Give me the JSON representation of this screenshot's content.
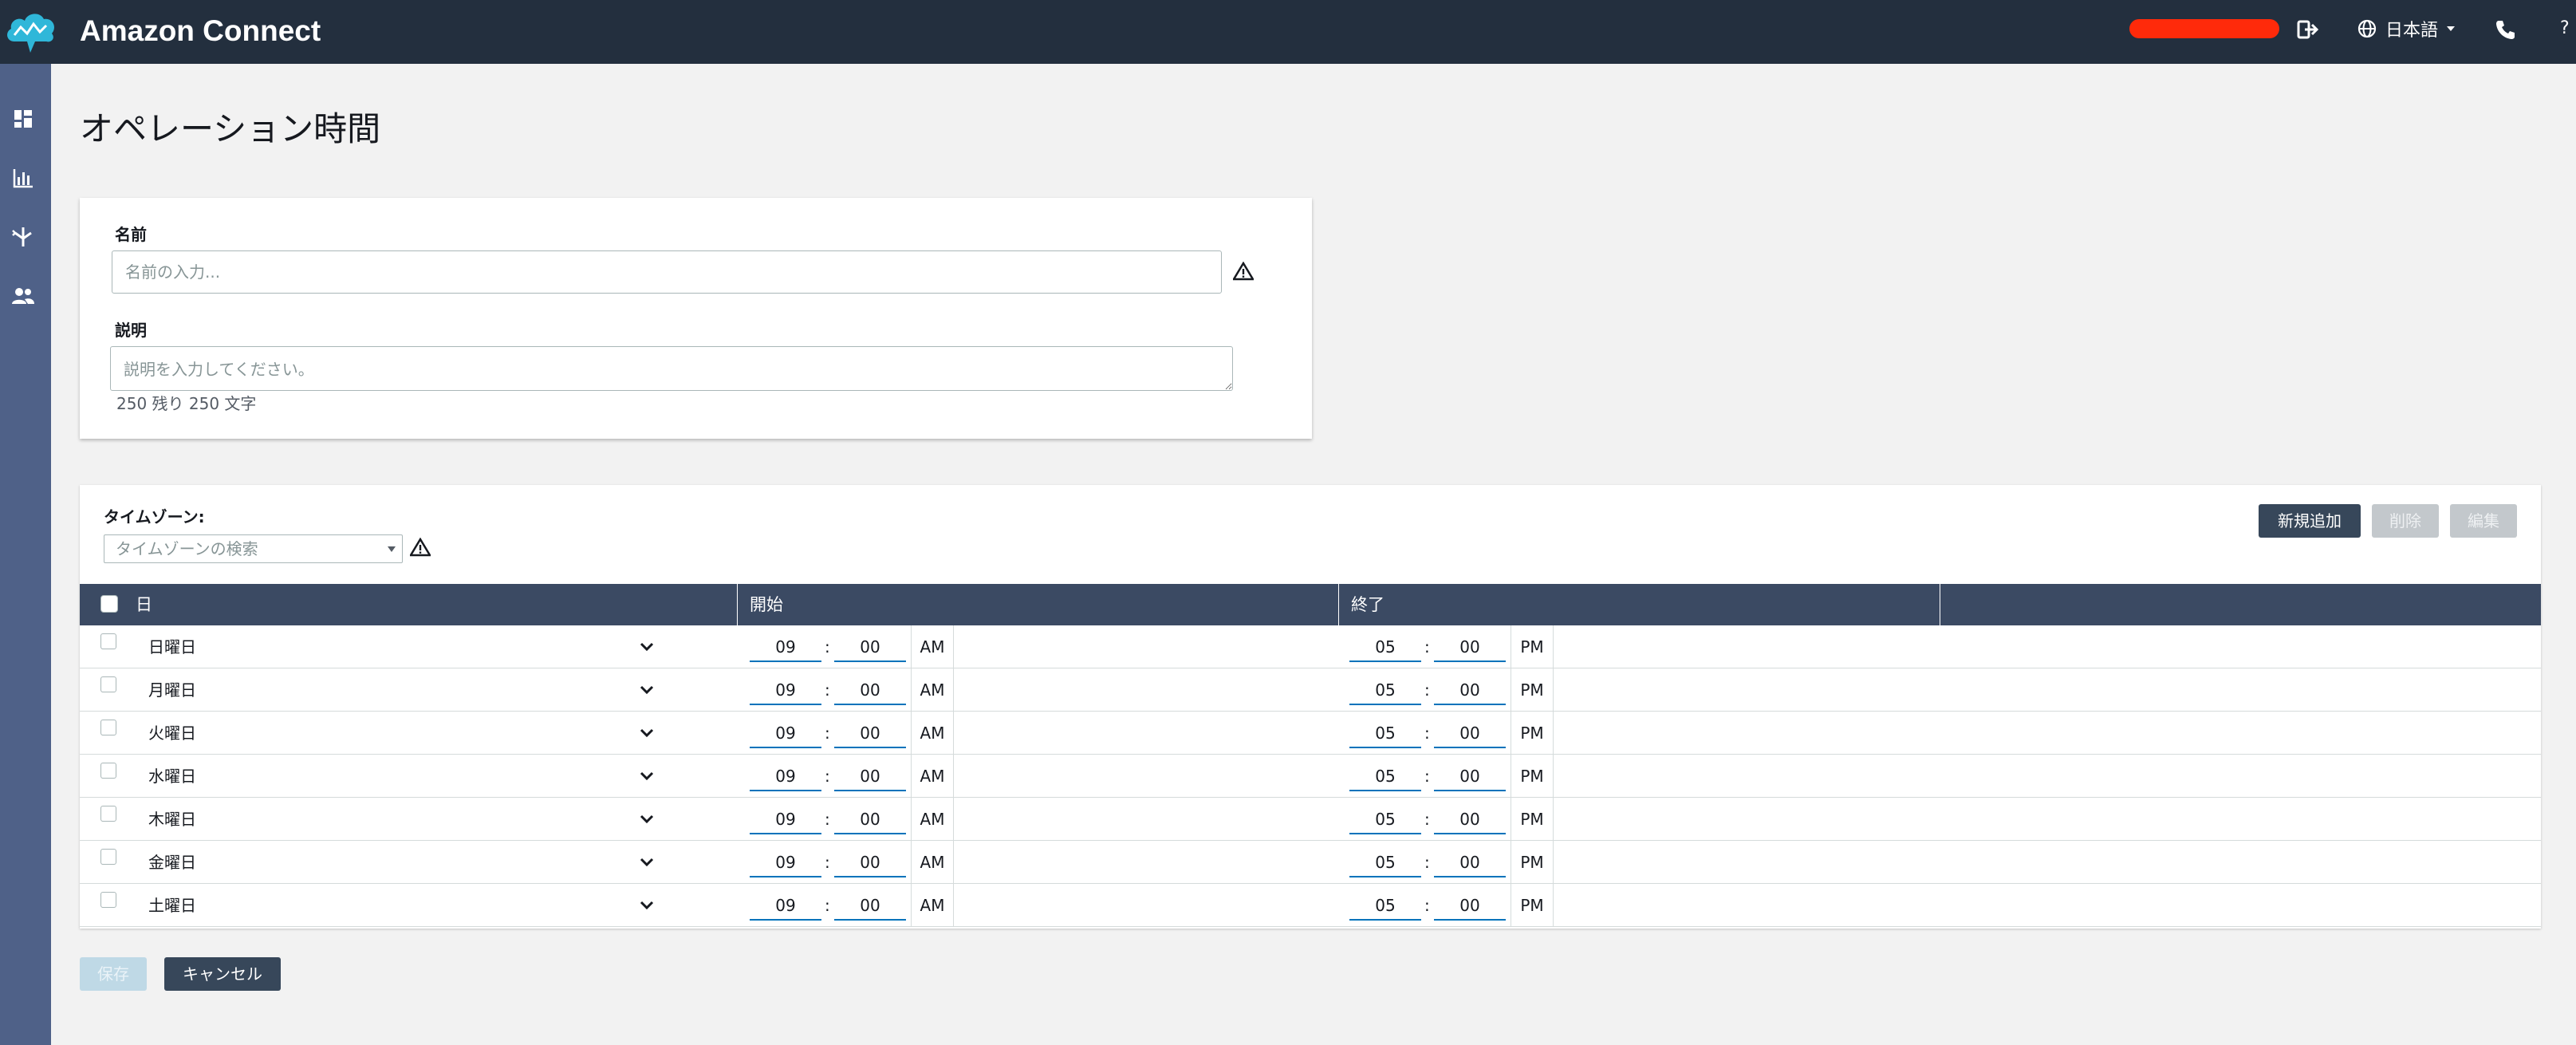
{
  "header": {
    "brand": "Amazon Connect",
    "language": "日本語",
    "help": "?"
  },
  "page": {
    "title": "オペレーション時間"
  },
  "form": {
    "name_label": "名前",
    "name_placeholder": "名前の入力...",
    "description_label": "説明",
    "description_placeholder": "説明を入力してください。",
    "counter": "250 残り 250 文字"
  },
  "timezone": {
    "label": "タイムゾーン:",
    "placeholder": "タイムゾーンの検索"
  },
  "actions": {
    "add": "新規追加",
    "delete": "削除",
    "edit": "編集"
  },
  "table": {
    "columns": {
      "day": "日",
      "start": "開始",
      "end": "終了"
    },
    "colon": ":",
    "rows": [
      {
        "day": "日曜日",
        "start_h": "09",
        "start_m": "00",
        "start_ampm": "AM",
        "end_h": "05",
        "end_m": "00",
        "end_ampm": "PM"
      },
      {
        "day": "月曜日",
        "start_h": "09",
        "start_m": "00",
        "start_ampm": "AM",
        "end_h": "05",
        "end_m": "00",
        "end_ampm": "PM"
      },
      {
        "day": "火曜日",
        "start_h": "09",
        "start_m": "00",
        "start_ampm": "AM",
        "end_h": "05",
        "end_m": "00",
        "end_ampm": "PM"
      },
      {
        "day": "水曜日",
        "start_h": "09",
        "start_m": "00",
        "start_ampm": "AM",
        "end_h": "05",
        "end_m": "00",
        "end_ampm": "PM"
      },
      {
        "day": "木曜日",
        "start_h": "09",
        "start_m": "00",
        "start_ampm": "AM",
        "end_h": "05",
        "end_m": "00",
        "end_ampm": "PM"
      },
      {
        "day": "金曜日",
        "start_h": "09",
        "start_m": "00",
        "start_ampm": "AM",
        "end_h": "05",
        "end_m": "00",
        "end_ampm": "PM"
      },
      {
        "day": "土曜日",
        "start_h": "09",
        "start_m": "00",
        "start_ampm": "AM",
        "end_h": "05",
        "end_m": "00",
        "end_ampm": "PM"
      }
    ]
  },
  "footer": {
    "save": "保存",
    "cancel": "キャンセル"
  },
  "icons": {
    "logo": "cloud-logo-icon",
    "logout": "logout-icon",
    "globe": "globe-icon",
    "phone": "phone-icon",
    "sidebar": [
      "dashboard-icon",
      "metrics-icon",
      "routing-icon",
      "users-icon"
    ],
    "warning": "warning-icon",
    "chevron": "chevron-down-icon"
  },
  "colors": {
    "topbar": "#232f3e",
    "sidebar": "#4f6188",
    "table_header": "#3b4a63",
    "primary_button": "#37475a",
    "user_pill": "#ff2a0a",
    "time_underline": "#0073bb"
  }
}
